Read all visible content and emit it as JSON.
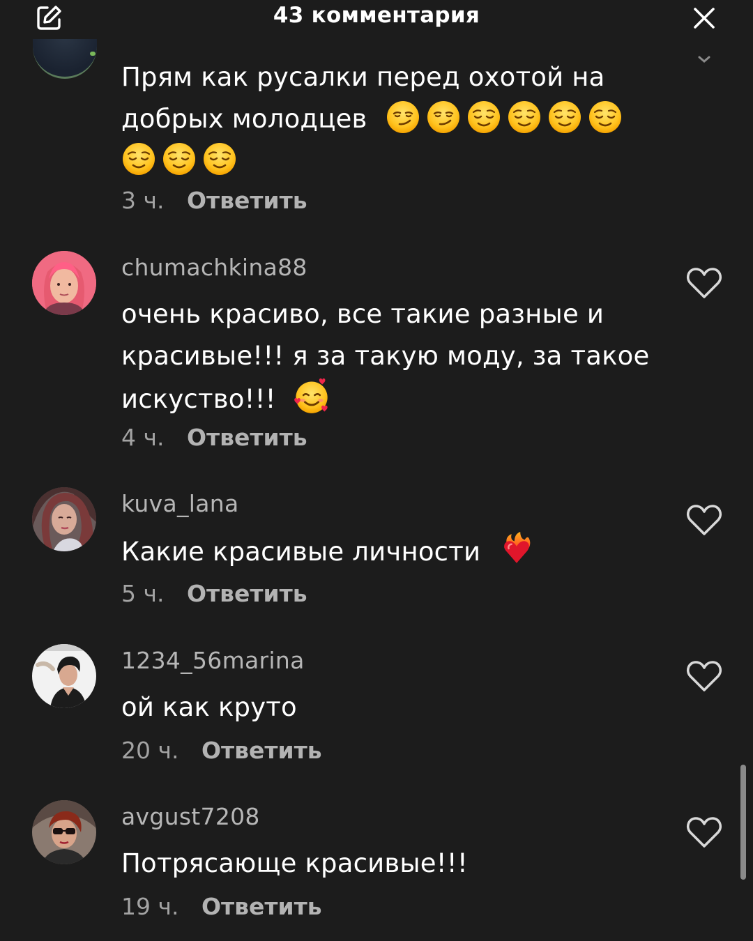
{
  "header": {
    "title": "43 комментария"
  },
  "comments": [
    {
      "text": "Прям как русалки перед охотой на добрых молодцев",
      "emojis": [
        "smirk",
        "smirk",
        "relieved",
        "relieved",
        "relieved",
        "relieved",
        "relieved",
        "relieved",
        "relieved"
      ],
      "time": "3 ч.",
      "reply_label": "Ответить"
    },
    {
      "username": "chumachkina88",
      "text": "очень красиво, все такие разные и красивые!!! я за такую моду, за такое искуство!!!",
      "emojis": [
        "smiling-face-with-hearts"
      ],
      "time": "4 ч.",
      "reply_label": "Ответить"
    },
    {
      "username": "kuva_lana",
      "text": "Какие красивые личности",
      "emojis": [
        "heart-on-fire"
      ],
      "time": "5 ч.",
      "reply_label": "Ответить"
    },
    {
      "username": "1234_56marina",
      "text": "ой как круто",
      "time": "20 ч.",
      "reply_label": "Ответить"
    },
    {
      "username": "avgust7208",
      "text": "Потрясающе красивые!!!",
      "time": "19 ч.",
      "reply_label": "Ответить"
    }
  ],
  "colors": {
    "background": "#1c1c1c",
    "text": "#ffffff",
    "username": "#b6b6b6",
    "meta": "#a3a3a3"
  }
}
